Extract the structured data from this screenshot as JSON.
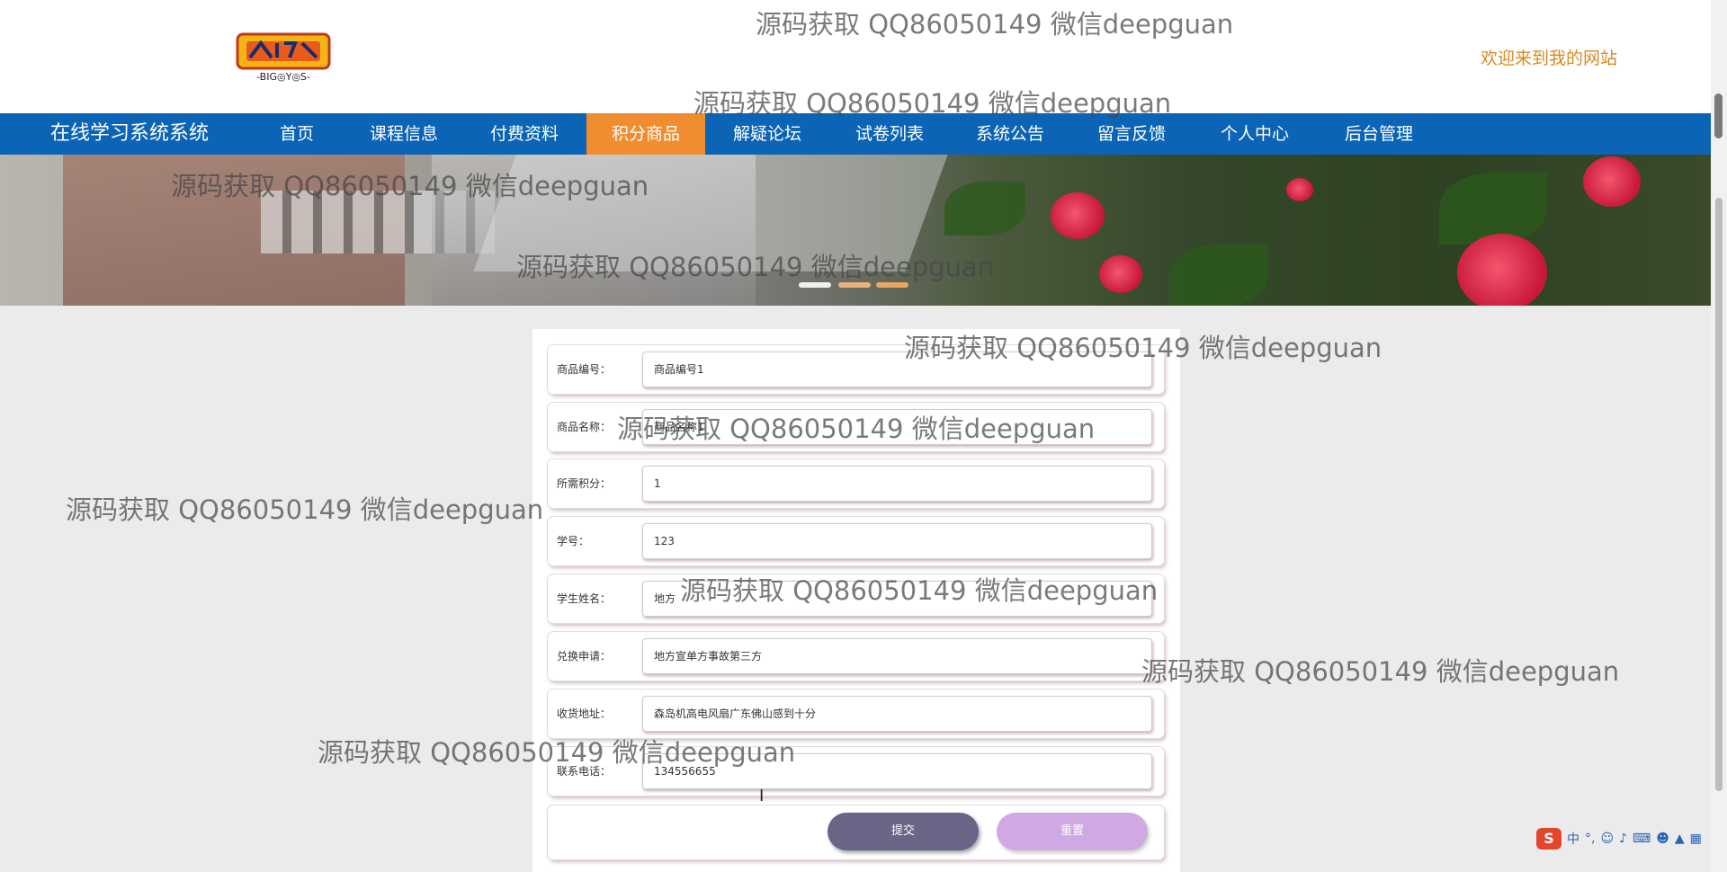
{
  "header": {
    "logo_alt": "Digimon Adventure BIGOYOS logo",
    "welcome": "欢迎来到我的网站"
  },
  "nav": {
    "site_title": "在线学习系统系统",
    "items": [
      "首页",
      "课程信息",
      "付费资料",
      "积分商品",
      "解疑论坛",
      "试卷列表",
      "系统公告",
      "留言反馈",
      "个人中心",
      "后台管理"
    ],
    "active_index": 3
  },
  "carousel": {
    "active_slide": 1,
    "slide_count": 3
  },
  "form": {
    "fields": [
      {
        "label": "商品编号：",
        "value": "商品编号1"
      },
      {
        "label": "商品名称：",
        "value": "商品名称1"
      },
      {
        "label": "所需积分：",
        "value": "1"
      },
      {
        "label": "学号：",
        "value": "123"
      },
      {
        "label": "学生姓名：",
        "value": "地方"
      },
      {
        "label": "兑换申请：",
        "value": "地方宣单方事故第三方"
      },
      {
        "label": "收货地址：",
        "value": "森岛机高电风扇广东佛山感到十分"
      },
      {
        "label": "联系电话：",
        "value": "134556655"
      }
    ],
    "submit_label": "提交",
    "reset_label": "重置"
  },
  "watermark": "源码获取 QQ86050149 微信deepguan",
  "ime": {
    "mode": "中"
  },
  "colors": {
    "nav_bg": "#0b64b5",
    "nav_active": "#f08d2e",
    "welcome": "#d7891f",
    "submit": "#696586",
    "reset": "#d0a9e4"
  }
}
